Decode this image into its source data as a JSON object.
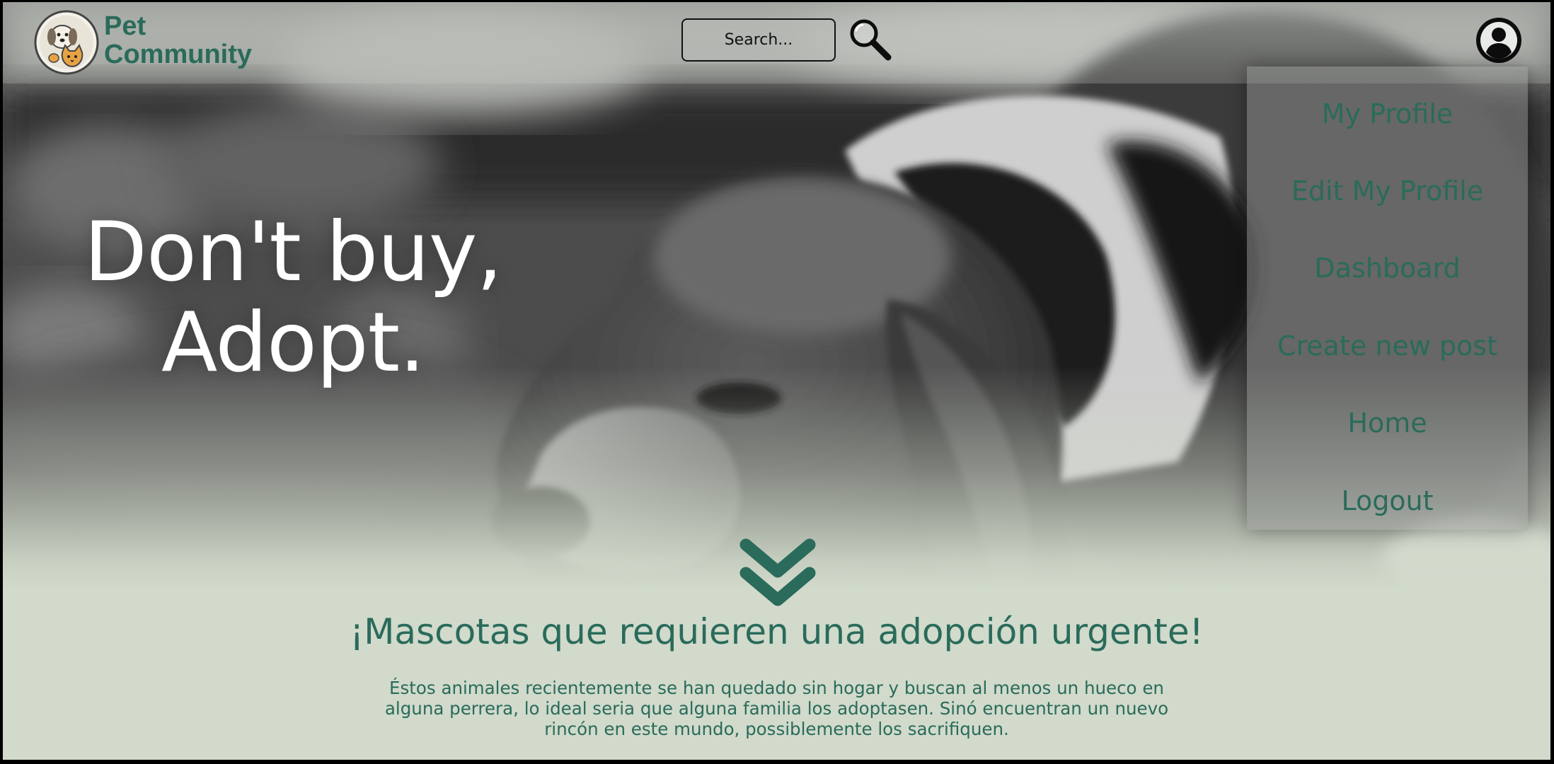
{
  "header": {
    "brand_line1": "Pet",
    "brand_line2": "Community",
    "logo_icon": "pet-dog-cat-logo",
    "search_placeholder": "Search...",
    "search_icon": "magnifier-icon",
    "avatar_icon": "user-circle-icon"
  },
  "hero": {
    "tagline_line1": "Don't buy,",
    "tagline_line2": "Adopt.",
    "scroll_icon": "double-chevron-down-icon"
  },
  "menu": {
    "items": [
      {
        "label": "My Profile"
      },
      {
        "label": "Edit My Profile"
      },
      {
        "label": "Dashboard"
      },
      {
        "label": "Create new post"
      },
      {
        "label": "Home"
      },
      {
        "label": "Logout"
      }
    ]
  },
  "section": {
    "title": "¡Mascotas que requieren una adopción urgente!",
    "body_line1": "Éstos animales recientemente se han quedado sin hogar y buscan al menos un hueco en",
    "body_line2": "alguna perrera, lo ideal seria que alguna familia los adoptasen. Sinó encuentran un nuevo",
    "body_line3": "rincón en este mundo, possiblemente los sacrifiquen."
  },
  "colors": {
    "accent": "#2a6b5b",
    "section_bg": "#d1dacb",
    "tagline": "#ffffff"
  }
}
